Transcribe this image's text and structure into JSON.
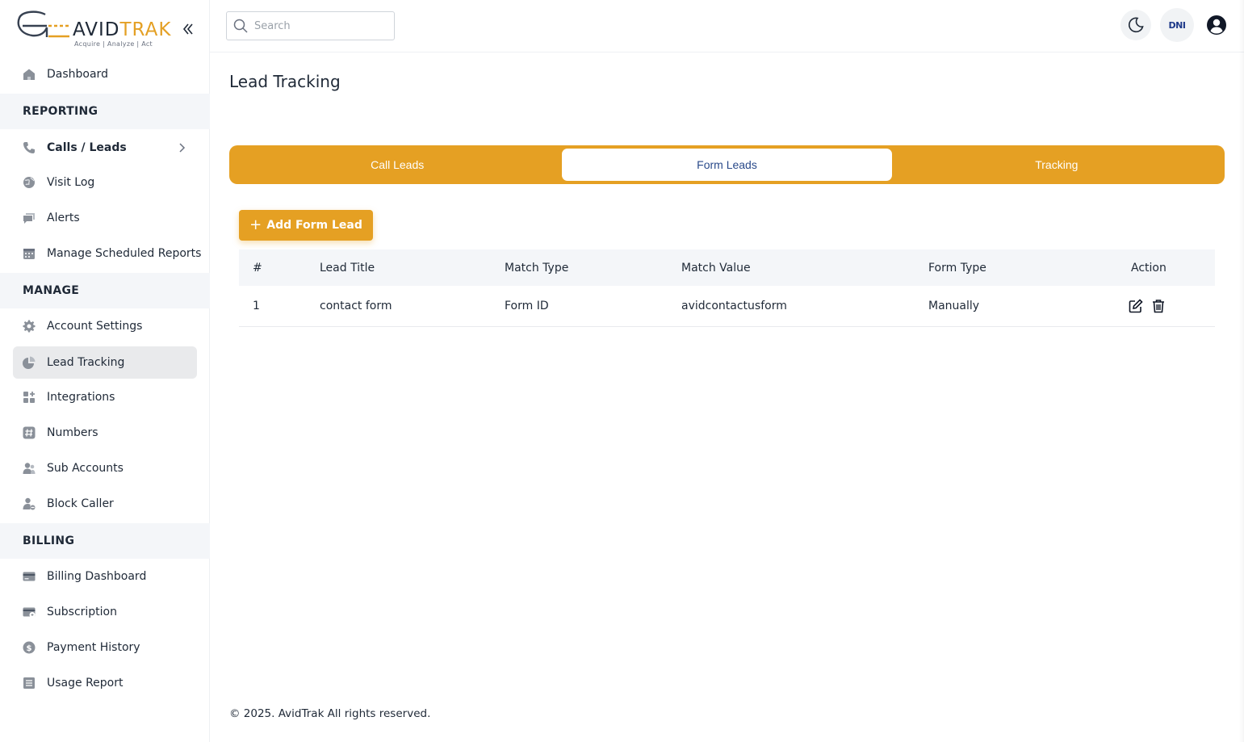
{
  "brand": {
    "name_part1": "AVID",
    "name_part2": "TRAK",
    "tagline": "Acquire   |   Analyze   |   Act",
    "accent_color": "#e5a023"
  },
  "sidebar": {
    "dashboard": "Dashboard",
    "sections": {
      "reporting": "REPORTING",
      "manage": "MANAGE",
      "billing": "BILLING"
    },
    "reporting_items": [
      {
        "label": "Calls / Leads",
        "icon": "phone-icon"
      },
      {
        "label": "Visit Log",
        "icon": "globe-icon"
      },
      {
        "label": "Alerts",
        "icon": "chat-icon"
      },
      {
        "label": "Manage Scheduled Reports",
        "icon": "calendar-icon"
      }
    ],
    "manage_items": [
      {
        "label": "Account Settings",
        "icon": "gear-icon"
      },
      {
        "label": "Lead Tracking",
        "icon": "pie-chart-icon",
        "active": true
      },
      {
        "label": "Integrations",
        "icon": "apps-icon"
      },
      {
        "label": "Numbers",
        "icon": "hash-icon"
      },
      {
        "label": "Sub Accounts",
        "icon": "users-icon"
      },
      {
        "label": "Block Caller",
        "icon": "user-block-icon"
      }
    ],
    "billing_items": [
      {
        "label": "Billing Dashboard",
        "icon": "credit-card-icon"
      },
      {
        "label": "Subscription",
        "icon": "subscription-card-icon"
      },
      {
        "label": "Payment History",
        "icon": "dollar-icon"
      },
      {
        "label": "Usage Report",
        "icon": "list-icon"
      }
    ]
  },
  "header": {
    "search_placeholder": "Search",
    "dni_label": "DNI"
  },
  "main": {
    "title": "Lead Tracking",
    "tabs": [
      {
        "label": "Call Leads",
        "active": false
      },
      {
        "label": "Form Leads",
        "active": true
      },
      {
        "label": "Tracking",
        "active": false
      }
    ],
    "add_button": "Add Form Lead",
    "table": {
      "headers": [
        "#",
        "Lead Title",
        "Match Type",
        "Match Value",
        "Form Type",
        "Action"
      ],
      "rows": [
        [
          "1",
          "contact form",
          "Form ID",
          "avidcontactusform",
          "Manually"
        ]
      ]
    }
  },
  "footer": {
    "text": "© 2025. AvidTrak All rights reserved."
  }
}
